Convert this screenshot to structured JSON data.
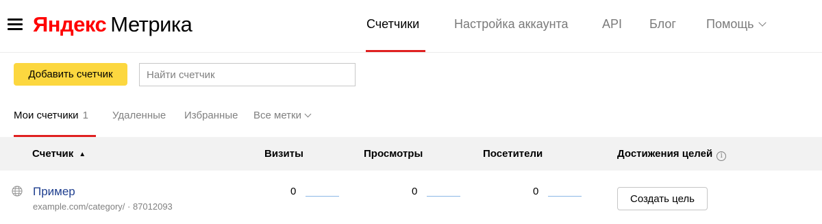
{
  "header": {
    "logo_brand": "Яндекс",
    "logo_product": "Метрика",
    "nav": [
      {
        "label": "Счетчики",
        "active": true
      },
      {
        "label": "Настройка аккаунта",
        "active": false
      },
      {
        "label": "API",
        "active": false
      },
      {
        "label": "Блог",
        "active": false
      },
      {
        "label": "Помощь",
        "active": false
      }
    ]
  },
  "toolbar": {
    "add_label": "Добавить счетчик",
    "search_placeholder": "Найти счетчик"
  },
  "tabs": {
    "my": {
      "label": "Мои счетчики",
      "count": "1"
    },
    "deleted": "Удаленные",
    "favorites": "Избранные",
    "all_tags": "Все метки"
  },
  "table": {
    "columns": {
      "counter": "Счетчик",
      "sort_indicator": "▲",
      "visits": "Визиты",
      "views": "Просмотры",
      "visitors": "Посетители",
      "goals": "Достижения целей",
      "goals_info": "i"
    },
    "rows": [
      {
        "name": "Пример",
        "subtitle": "example.com/category/ · 87012093",
        "visits": "0",
        "views": "0",
        "visitors": "0",
        "goal_button": "Создать цель"
      }
    ]
  },
  "colors": {
    "accent_red": "#e02020",
    "brand_red": "#ff0000",
    "button_yellow": "#fcd73f",
    "link_blue": "#1f3f8f",
    "sparkline": "#8ab8e6"
  },
  "icons": [
    "hamburger-menu-icon",
    "chevron-down-icon",
    "sort-up-icon",
    "info-icon",
    "globe-icon"
  ]
}
